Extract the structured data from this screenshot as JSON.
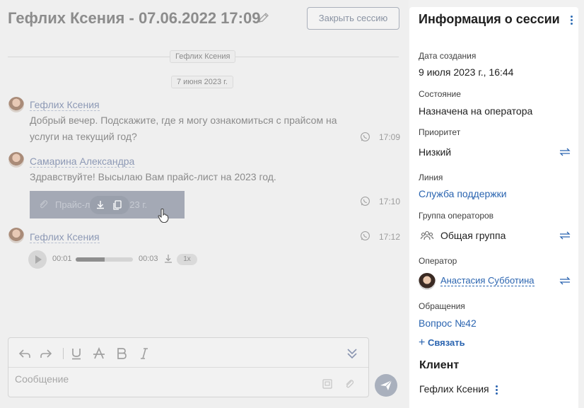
{
  "session": {
    "title": "Гефлих Ксения - 07.06.2022 17:09",
    "close_label": "Закрыть сессию"
  },
  "feed": {
    "participant_chip": "Гефлих Ксения",
    "date_chip": "7 июня 2023 г.",
    "messages": [
      {
        "sender": "Гефлих Ксения",
        "text": "Добрый вечер. Подскажите, где я могу ознакомиться с прайсом на услуги на текущий год?",
        "time": "17:09",
        "channel_icon": "whatsapp-icon"
      },
      {
        "sender": "Самарина Александра",
        "text": "Здравствуйте! Высылаю Вам прайс-лист на 2023 год.",
        "time": "17:10",
        "channel_icon": "whatsapp-icon",
        "attachment": {
          "name": "Прайс-лист на 2023 г.",
          "icon": "paperclip-icon"
        }
      },
      {
        "sender": "Гефлих Ксения",
        "time": "17:12",
        "channel_icon": "whatsapp-icon",
        "audio": {
          "current": "00:01",
          "duration": "00:03",
          "progress": 0.5,
          "speed": "1x"
        }
      }
    ]
  },
  "composer": {
    "placeholder": "Сообщение",
    "tools": [
      "undo-icon",
      "redo-icon",
      "underline-icon",
      "strikethrough-icon",
      "bold-icon",
      "italic-icon",
      "collapse-icon"
    ]
  },
  "panel": {
    "title": "Информация о сессии",
    "created_label": "Дата создания",
    "created_value": "9 июля 2023 г., 16:44",
    "state_label": "Состояние",
    "state_value": "Назначена на оператора",
    "priority_label": "Приоритет",
    "priority_value": "Низкий",
    "line_label": "Линия",
    "line_value": "Служба поддержки",
    "group_label": "Группа операторов",
    "group_value": "Общая группа",
    "operator_label": "Оператор",
    "operator_value": "Анастасия Субботина",
    "requests_label": "Обращения",
    "requests_value": "Вопрос №42",
    "link_button": "Связать",
    "client_section": "Клиент",
    "client_name": "Гефлих Ксения"
  },
  "colors": {
    "accent": "#2a64b0",
    "muted_text": "#8b8b8b",
    "send_button": "#a9b0bd"
  }
}
